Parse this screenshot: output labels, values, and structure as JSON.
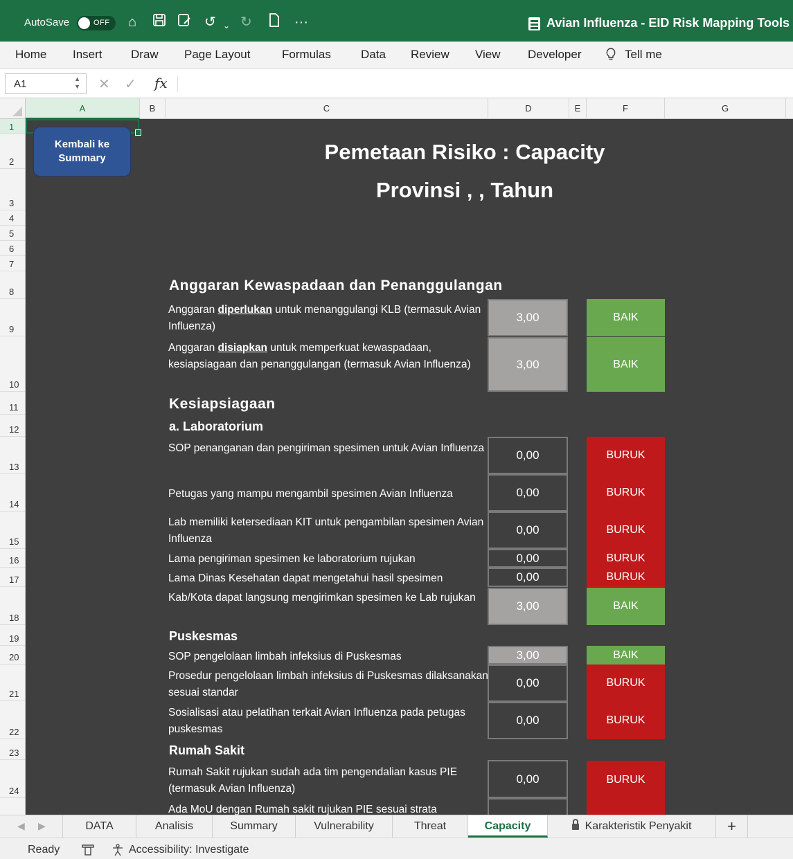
{
  "titlebar": {
    "autosave_label": "AutoSave",
    "autosave_state": "OFF",
    "title": "Avian Influenza - EID Risk Mapping Tools",
    "quick_access_icons": [
      "home-icon",
      "save-icon",
      "save-as-icon",
      "undo-icon",
      "redo-icon",
      "new-file-icon",
      "more-icon"
    ]
  },
  "ribbon": {
    "tabs": [
      "Home",
      "Insert",
      "Draw",
      "Page Layout",
      "Formulas",
      "Data",
      "Review",
      "View",
      "Developer",
      "Tell me"
    ]
  },
  "formula_bar": {
    "name_box": "A1",
    "fx": "fx",
    "formula": ""
  },
  "columns": [
    "A",
    "B",
    "C",
    "D",
    "E",
    "F",
    "G"
  ],
  "rows": [
    "1",
    "2",
    "3",
    "4",
    "5",
    "6",
    "7",
    "8",
    "9",
    "10",
    "11",
    "12",
    "13",
    "14",
    "15",
    "16",
    "17",
    "18",
    "19",
    "20",
    "21",
    "22",
    "23",
    "24"
  ],
  "sheet": {
    "back_button": "Kembali ke\nSummary",
    "title": "Pemetaan Risiko : Capacity",
    "subtitle": "Provinsi , , Tahun",
    "section_budget": "Anggaran Kewaspadaan dan Penanggulangan",
    "section_preparedness": "Kesiapsiagaan",
    "sub_lab": "a. Laboratorium",
    "sub_puskesmas": "Puskesmas",
    "sub_rs": "Rumah Sakit",
    "items": [
      {
        "pre": "Anggaran ",
        "u": "diperlukan",
        "post": " untuk menanggulangi KLB (termasuk Avian Influenza)",
        "value": "3,00",
        "status": "BAIK"
      },
      {
        "pre": "Anggaran ",
        "u": "disiapkan",
        "post": " untuk memperkuat kewaspadaan, kesiapsiagaan dan penanggulangan (termasuk Avian Influenza)",
        "value": "3,00",
        "status": "BAIK"
      },
      {
        "text": "SOP penanganan dan pengiriman spesimen untuk Avian Influenza",
        "value": "0,00",
        "status": "BURUK"
      },
      {
        "text": "Petugas yang mampu mengambil spesimen Avian Influenza",
        "value": "0,00",
        "status": "BURUK"
      },
      {
        "text": "Lab memiliki ketersediaan KIT untuk pengambilan spesimen Avian Influenza",
        "value": "0,00",
        "status": "BURUK"
      },
      {
        "text": "Lama pengiriman spesimen ke laboratorium rujukan",
        "value": "0,00",
        "status": "BURUK"
      },
      {
        "text": "Lama Dinas Kesehatan dapat mengetahui hasil spesimen",
        "value": "0,00",
        "status": "BURUK"
      },
      {
        "text": "Kab/Kota dapat langsung mengirimkan spesimen ke Lab rujukan",
        "value": "3,00",
        "status": "BAIK"
      },
      {
        "text": "SOP pengelolaan limbah infeksius di Puskesmas",
        "value": "3,00",
        "status": "BAIK"
      },
      {
        "text": "Prosedur pengelolaan limbah infeksius di Puskesmas dilaksanakan sesuai standar",
        "value": "0,00",
        "status": "BURUK"
      },
      {
        "text": "Sosialisasi atau pelatihan terkait Avian Influenza pada petugas puskesmas",
        "value": "0,00",
        "status": "BURUK"
      },
      {
        "text": "Rumah Sakit rujukan sudah ada tim pengendalian kasus PIE (termasuk Avian Influenza)",
        "value": "0,00",
        "status": "BURUK"
      },
      {
        "text": "Ada MoU dengan Rumah sakit rujukan PIE sesuai strata"
      }
    ]
  },
  "sheet_tabs": [
    "DATA",
    "Analisis",
    "Summary",
    "Vulnerability",
    "Threat",
    "Capacity",
    "Karakteristik Penyakit"
  ],
  "active_sheet": "Capacity",
  "statusbar": {
    "ready": "Ready",
    "accessibility": "Accessibility: Investigate"
  },
  "colors": {
    "excel_green": "#1d7044",
    "sheet_bg": "#3f3f3f",
    "good": "#6aa84f",
    "bad": "#c0191b",
    "gray_value": "#a5a2a2",
    "button_blue": "#2f5597"
  }
}
